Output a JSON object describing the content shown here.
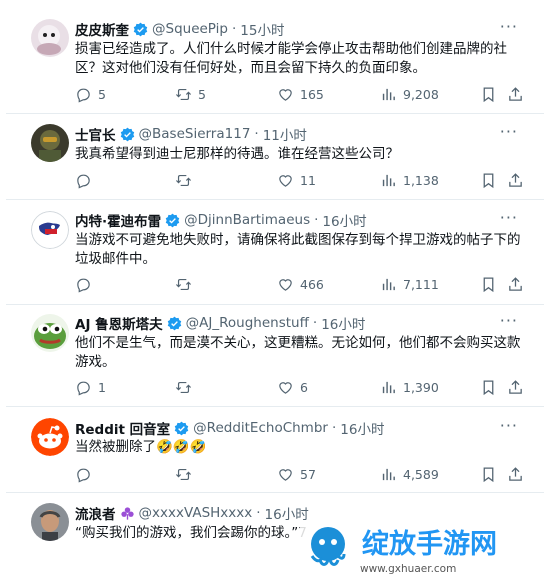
{
  "tweets": [
    {
      "name": "皮皮斯奎",
      "handle": "@SqueePip",
      "dot": "·",
      "time": "15小时",
      "text": "损害已经造成了。人们什么时候才能学会停止攻击帮助他们创建品牌的社区？这对他们没有任何好处，而且会留下持久的负面印象。",
      "replies": "5",
      "retweets": "5",
      "likes": "165",
      "views": "9,208",
      "verified": true
    },
    {
      "name": "士官长",
      "handle": "@BaseSierra117",
      "dot": "·",
      "time": "11小时",
      "text": "我真希望得到迪士尼那样的待遇。谁在经营这些公司？",
      "replies": "",
      "retweets": "",
      "likes": "11",
      "views": "1,138",
      "verified": true
    },
    {
      "name": "内特·霍迪布雷",
      "handle": "@DjinnBartimaeus",
      "dot": "·",
      "time": "16小时",
      "text": "当游戏不可避免地失败时，请确保将此截图保存到每个捍卫游戏的帖子下的垃圾邮件中。",
      "replies": "",
      "retweets": "",
      "likes": "466",
      "views": "7,111",
      "verified": true
    },
    {
      "name": "AJ 鲁恩斯塔夫",
      "handle": "@AJ_Roughenstuff",
      "dot": "·",
      "time": "16小时",
      "text": "他们不是生气，而是漠不关心，这更糟糕。无论如何，他们都不会购买这款游戏。",
      "replies": "1",
      "retweets": "",
      "likes": "6",
      "views": "1,390",
      "verified": true
    },
    {
      "name": "Reddit 回音室",
      "handle": "@RedditEchoChmbr",
      "dot": "·",
      "time": "16小时",
      "text": "当然被删除了🤣🤣🤣",
      "replies": "",
      "retweets": "",
      "likes": "57",
      "views": "4,589",
      "verified": true
    },
    {
      "name": "流浪者",
      "handle": "@xxxxVASHxxxx",
      "dot": "·",
      "time": "16小时",
      "text": "“购买我们的游戏，我们会踢你的球。”7",
      "verified": false
    }
  ],
  "more_label": "···",
  "watermark": {
    "title": "绽放手游网",
    "url": "www.gxhuaer.com"
  },
  "colors": {
    "verified": "#1d9bf0",
    "secondary_text": "#536471",
    "divider": "#e6ecf0"
  }
}
